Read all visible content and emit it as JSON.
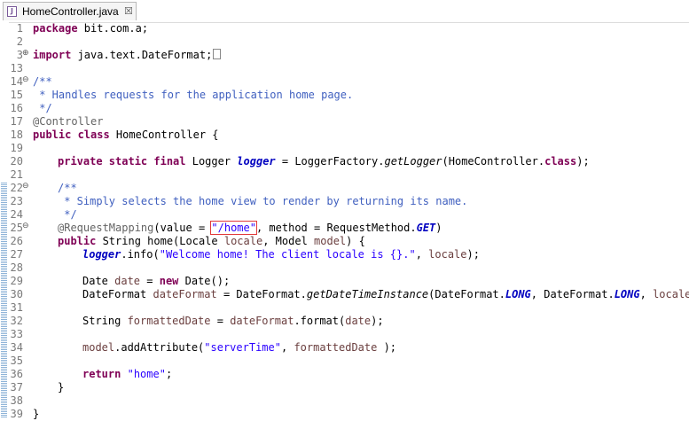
{
  "tab": {
    "title": "HomeController.java",
    "close": "☒"
  },
  "lines": [
    {
      "n": "1",
      "fold": ""
    },
    {
      "n": "2",
      "fold": ""
    },
    {
      "n": "3",
      "fold": "⊕"
    },
    {
      "n": "13",
      "fold": ""
    },
    {
      "n": "14",
      "fold": "⊖"
    },
    {
      "n": "15",
      "fold": ""
    },
    {
      "n": "16",
      "fold": ""
    },
    {
      "n": "17",
      "fold": ""
    },
    {
      "n": "18",
      "fold": ""
    },
    {
      "n": "19",
      "fold": ""
    },
    {
      "n": "20",
      "fold": ""
    },
    {
      "n": "21",
      "fold": ""
    },
    {
      "n": "22",
      "fold": "⊖"
    },
    {
      "n": "23",
      "fold": ""
    },
    {
      "n": "24",
      "fold": ""
    },
    {
      "n": "25",
      "fold": "⊖"
    },
    {
      "n": "26",
      "fold": ""
    },
    {
      "n": "27",
      "fold": ""
    },
    {
      "n": "28",
      "fold": ""
    },
    {
      "n": "29",
      "fold": ""
    },
    {
      "n": "30",
      "fold": ""
    },
    {
      "n": "31",
      "fold": ""
    },
    {
      "n": "32",
      "fold": ""
    },
    {
      "n": "33",
      "fold": ""
    },
    {
      "n": "34",
      "fold": ""
    },
    {
      "n": "35",
      "fold": ""
    },
    {
      "n": "36",
      "fold": ""
    },
    {
      "n": "37",
      "fold": ""
    },
    {
      "n": "38",
      "fold": ""
    },
    {
      "n": "39",
      "fold": ""
    }
  ],
  "code": {
    "l1_kw": "package",
    "l1_rest": " bit.com.a;",
    "l3_kw": "import",
    "l3_rest": " java.text.DateFormat;",
    "l14": "/**",
    "l15": " * Handles requests for the application home page.",
    "l16": " */",
    "l17": "@Controller",
    "l18_kw": "public class",
    "l18_rest": " HomeController {",
    "l20_kw": "private static final",
    "l20_a": " Logger ",
    "l20_f": "logger",
    "l20_b": " = LoggerFactory.",
    "l20_m": "getLogger",
    "l20_c": "(HomeController.",
    "l20_kw2": "class",
    "l20_d": ");",
    "l22": "/**",
    "l23": " * Simply selects the home view to render by returning its name.",
    "l24": " */",
    "l25_a": "@RequestMapping",
    "l25_b": "(value = ",
    "l25_s": "\"/home\"",
    "l25_c": ", method = RequestMethod.",
    "l25_f": "GET",
    "l25_d": ")",
    "l26_kw": "public",
    "l26_a": " String home(Locale ",
    "l26_p1": "locale",
    "l26_b": ", Model ",
    "l26_p2": "model",
    "l26_c": ") {",
    "l27_f": "logger",
    "l27_a": ".info(",
    "l27_s": "\"Welcome home! The client locale is {}.\"",
    "l27_b": ", ",
    "l27_p": "locale",
    "l27_c": ");",
    "l29_a": "Date ",
    "l29_v": "date",
    "l29_b": " = ",
    "l29_kw": "new",
    "l29_c": " Date();",
    "l30_a": "DateFormat ",
    "l30_v": "dateFormat",
    "l30_b": " = DateFormat.",
    "l30_m": "getDateTimeInstance",
    "l30_c": "(DateFormat.",
    "l30_f1": "LONG",
    "l30_d": ", DateFormat.",
    "l30_f2": "LONG",
    "l30_e": ", ",
    "l30_p": "locale",
    "l30_g": ");",
    "l32_a": "String ",
    "l32_v": "formattedDate",
    "l32_b": " = ",
    "l32_v2": "dateFormat",
    "l32_c": ".format(",
    "l32_v3": "date",
    "l32_d": ");",
    "l34_p": "model",
    "l34_a": ".addAttribute(",
    "l34_s": "\"serverTime\"",
    "l34_b": ", ",
    "l34_v": "formattedDate",
    "l34_c": " );",
    "l36_kw": "return",
    "l36_sp": " ",
    "l36_s": "\"home\"",
    "l36_a": ";",
    "l37": "}",
    "l39": "}"
  },
  "colors": {
    "keyword": "#7f0055",
    "string": "#2a00ff",
    "comment": "#3f5fbf",
    "field": "#0000c0",
    "highlight": "#e23a3a"
  }
}
